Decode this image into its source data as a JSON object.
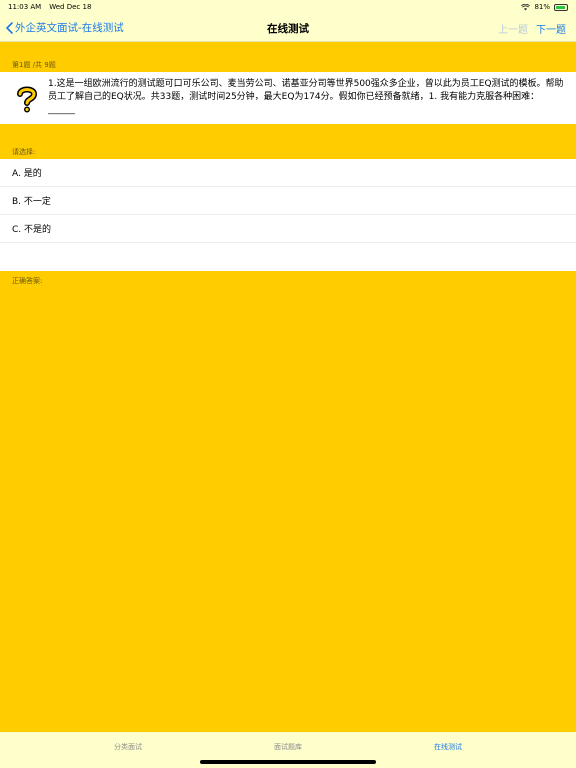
{
  "status_bar": {
    "time": "11:03 AM",
    "date": "Wed Dec 18",
    "battery": "81%"
  },
  "nav": {
    "back_label": "外企英文面试-在线测试",
    "title": "在线测试",
    "prev_label": "上一题",
    "next_label": "下一题"
  },
  "question": {
    "header": "第1题 /共 9题",
    "text": "1.这是一组欧洲流行的测试题可口可乐公司、麦当劳公司、诺基亚分司等世界500强众多企业，曾以此为员工EQ测试的模板。帮助员工了解自己的EQ状况。共33题，测试时间25分钟，最大EQ为174分。假如你已经预备就绪，1.  我有能力克服各种困难：______"
  },
  "select_label": "请选择:",
  "options": [
    {
      "label": "A. 是的"
    },
    {
      "label": "B. 不一定"
    },
    {
      "label": "C.  不是的"
    }
  ],
  "answer_label": "正确答案:",
  "tabs": [
    {
      "label": "分类面试",
      "active": false
    },
    {
      "label": "面试题库",
      "active": false
    },
    {
      "label": "在线测试",
      "active": true
    }
  ],
  "colors": {
    "background": "#FFCC00",
    "bar": "#FFFFCC",
    "accent": "#1a7ae8"
  },
  "icons": {
    "question": "question-mark-icon",
    "back": "chevron-left-icon",
    "wifi": "wifi-icon",
    "battery": "battery-icon"
  }
}
